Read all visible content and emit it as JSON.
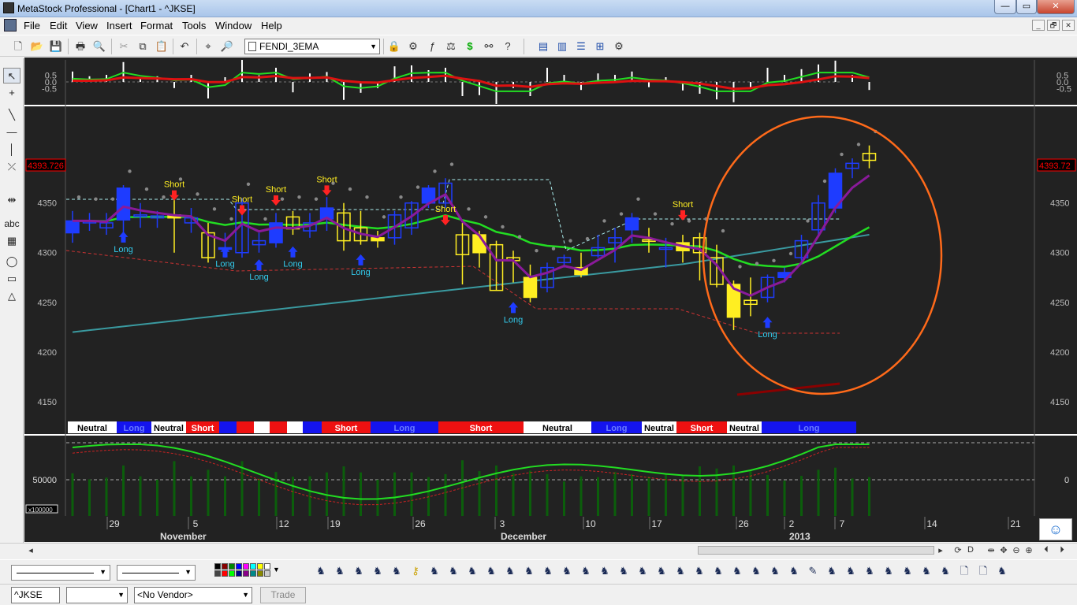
{
  "window": {
    "title": "MetaStock Professional - [Chart1 - ^JKSE]",
    "controls": {
      "minimize": "—",
      "maximize": "▭",
      "close": "✕"
    },
    "mdi_controls": {
      "minimize": "_",
      "restore": "🗗",
      "close": "✕"
    }
  },
  "menu": [
    "File",
    "Edit",
    "View",
    "Insert",
    "Format",
    "Tools",
    "Window",
    "Help"
  ],
  "toolbar": {
    "template_name": "FENDI_3EMA",
    "icons": [
      "new-icon",
      "open-icon",
      "save-icon",
      "print-icon",
      "print-preview-icon",
      "cut-icon",
      "copy-icon",
      "paste-icon",
      "undo-icon",
      "crosshair-icon",
      "zoom-icon",
      "expert-icon",
      "explorer-icon",
      "indicator-builder-icon",
      "system-tester-icon",
      "dollar-icon",
      "binoculars-icon",
      "help-cursor-icon",
      "cascade-icon",
      "tile-vertical-icon",
      "tile-horizontal-icon",
      "arrange-icon",
      "options-icon"
    ]
  },
  "left_tools": [
    "pointer-icon",
    "crosshair-icon",
    "trendline-icon",
    "horizontal-line-icon",
    "vertical-line-icon",
    "fibonacci-icon",
    "scroll-icon",
    "text-icon",
    "grid-icon",
    "ellipse-icon",
    "rectangle-icon",
    "triangle-icon"
  ],
  "left_tool_text": "abc",
  "colors": {
    "background": "#222222",
    "bull_candle": "#1e3cff",
    "bear_candle": "#ffee22",
    "ema_green": "#22dd22",
    "ema_purple": "#8a1a9a",
    "ema_teal": "#3a9aa0",
    "ellipse": "#ff6a1a",
    "short_label": "#ffee22",
    "long_label": "#33ccee",
    "short_arrow": "#ff2222",
    "long_arrow": "#1e3cff",
    "price_marker": "#ff0000"
  },
  "chart_data": {
    "type": "candlestick",
    "symbol": "^JKSE",
    "last_price": "4393.726",
    "last_price_right": "4393.72",
    "price_axis_ticks": [
      "4350",
      "4300",
      "4250",
      "4200",
      "4150"
    ],
    "ylim": [
      4130,
      4445
    ],
    "oscillator_axis_ticks": [
      "0.5",
      "0.0",
      "-0.5"
    ],
    "volume_axis_tick": "50000",
    "volume_multiplier": "x100000",
    "volume_right_tick": "0",
    "date_ticks": [
      "29",
      "5",
      "12",
      "19",
      "26",
      "3",
      "10",
      "17",
      "26",
      "2",
      "7",
      "14",
      "21"
    ],
    "month_labels": [
      "November",
      "December",
      "2013"
    ],
    "signals": [
      {
        "label": "Short",
        "x": 6,
        "price": 4358
      },
      {
        "label": "Short",
        "x": 10,
        "price": 4343
      },
      {
        "label": "Short",
        "x": 12,
        "price": 4353
      },
      {
        "label": "Short",
        "x": 15,
        "price": 4363
      },
      {
        "label": "Short",
        "x": 22,
        "price": 4333
      },
      {
        "label": "Short",
        "x": 36,
        "price": 4338
      },
      {
        "label": "Long",
        "x": 3,
        "price": 4315
      },
      {
        "label": "Long",
        "x": 9,
        "price": 4300
      },
      {
        "label": "Long",
        "x": 11,
        "price": 4287
      },
      {
        "label": "Long",
        "x": 13,
        "price": 4300
      },
      {
        "label": "Long",
        "x": 17,
        "price": 4292
      },
      {
        "label": "Long",
        "x": 26,
        "price": 4244
      },
      {
        "label": "Long",
        "x": 41,
        "price": 4229
      }
    ],
    "state_bar": [
      {
        "label": "Neutral",
        "type": "neutral"
      },
      {
        "label": "Long",
        "type": "long"
      },
      {
        "label": "Neutral",
        "type": "neutral"
      },
      {
        "label": "Short",
        "type": "short"
      },
      {
        "label": "",
        "type": "long"
      },
      {
        "label": "",
        "type": "short"
      },
      {
        "label": "",
        "type": "neutral"
      },
      {
        "label": "",
        "type": "short"
      },
      {
        "label": "",
        "type": "neutral"
      },
      {
        "label": "",
        "type": "long"
      },
      {
        "label": "Short",
        "type": "short"
      },
      {
        "label": "Long",
        "type": "long"
      },
      {
        "label": "Short",
        "type": "short"
      },
      {
        "label": "Neutral",
        "type": "neutral"
      },
      {
        "label": "Long",
        "type": "long"
      },
      {
        "label": "Neutral",
        "type": "neutral"
      },
      {
        "label": "Short",
        "type": "short"
      },
      {
        "label": "Neutral",
        "type": "neutral"
      },
      {
        "label": "Long",
        "type": "long"
      }
    ],
    "candles": [
      [
        4320,
        4332,
        4342,
        4310
      ],
      [
        4330,
        4332,
        4340,
        4322
      ],
      [
        4325,
        4330,
        4340,
        4318
      ],
      [
        4333,
        4365,
        4368,
        4318
      ],
      [
        4338,
        4338,
        4350,
        4325
      ],
      [
        4335,
        4337,
        4342,
        4325
      ],
      [
        4338,
        4335,
        4360,
        4300
      ],
      [
        4330,
        4335,
        4345,
        4320
      ],
      [
        4320,
        4295,
        4330,
        4290
      ],
      [
        4305,
        4305,
        4320,
        4295
      ],
      [
        4300,
        4350,
        4355,
        4295
      ],
      [
        4308,
        4312,
        4320,
        4300
      ],
      [
        4310,
        4330,
        4340,
        4305
      ],
      [
        4336,
        4324,
        4342,
        4318
      ],
      [
        4322,
        4330,
        4340,
        4315
      ],
      [
        4334,
        4345,
        4356,
        4322
      ],
      [
        4340,
        4312,
        4350,
        4302
      ],
      [
        4325,
        4312,
        4342,
        4308
      ],
      [
        4315,
        4312,
        4322,
        4305
      ],
      [
        4315,
        4338,
        4342,
        4308
      ],
      [
        4325,
        4350,
        4352,
        4318
      ],
      [
        4350,
        4365,
        4368,
        4345
      ],
      [
        4350,
        4370,
        4375,
        4345
      ],
      [
        4318,
        4298,
        4330,
        4268
      ],
      [
        4318,
        4300,
        4322,
        4285
      ],
      [
        4308,
        4262,
        4312,
        4262
      ],
      [
        4295,
        4292,
        4302,
        4270
      ],
      [
        4275,
        4255,
        4288,
        4250
      ],
      [
        4265,
        4285,
        4290,
        4260
      ],
      [
        4290,
        4295,
        4298,
        4285
      ],
      [
        4285,
        4278,
        4300,
        4275
      ],
      [
        4297,
        4305,
        4318,
        4295
      ],
      [
        4310,
        4315,
        4325,
        4290
      ],
      [
        4323,
        4335,
        4340,
        4310
      ],
      [
        4313,
        4312,
        4325,
        4300
      ],
      [
        4305,
        4305,
        4315,
        4285
      ],
      [
        4310,
        4302,
        4318,
        4290
      ],
      [
        4315,
        4300,
        4320,
        4272
      ],
      [
        4295,
        4268,
        4308,
        4265
      ],
      [
        4268,
        4235,
        4272,
        4222
      ],
      [
        4252,
        4248,
        4275,
        4236
      ],
      [
        4255,
        4275,
        4278,
        4250
      ],
      [
        4275,
        4280,
        4285,
        4270
      ],
      [
        4295,
        4312,
        4318,
        4292
      ],
      [
        4323,
        4350,
        4358,
        4318
      ],
      [
        4345,
        4380,
        4385,
        4340
      ],
      [
        4385,
        4390,
        4395,
        4375
      ],
      [
        4400,
        4393,
        4408,
        4385
      ]
    ]
  }
}
